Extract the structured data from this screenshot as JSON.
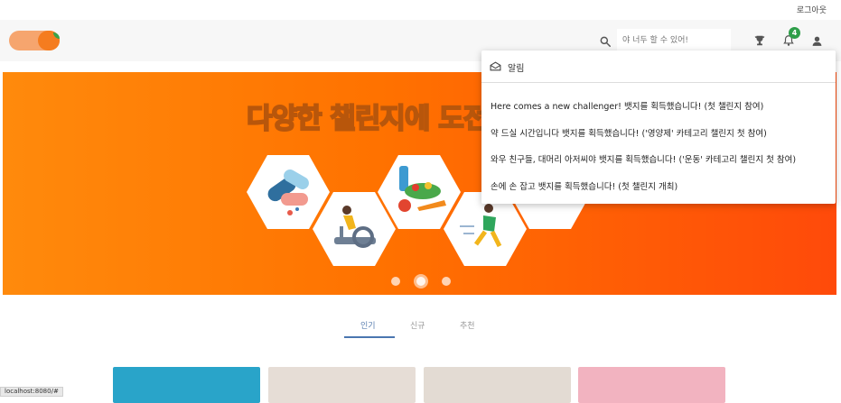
{
  "topbar": {
    "logout_label": "로그아웃"
  },
  "header": {
    "search_placeholder": "야 너두 할 수 있어!",
    "notification_count": "4",
    "icons": [
      "search-icon",
      "trophy-icon",
      "bell-icon",
      "person-icon"
    ]
  },
  "banner": {
    "title": "다양한 챌린지에 도전",
    "carousel": {
      "slide_count": 3,
      "active_slide": 2
    }
  },
  "notifications": {
    "header_label": "알림",
    "items": [
      "Here comes a new challenger! 뱃지를 획득했습니다! (첫 챌린지 참여)",
      "약 드실 시간입니다 뱃지를 획득했습니다! ('영양제' 카테고리 챌린지 첫 참여)",
      "와우 친구들, 대머리 아저씨야 뱃지를 획득했습니다! ('운동' 카테고리 챌린지 첫 참여)",
      "손에 손 잡고 뱃지를 획득했습니다! (첫 챌린지 개최)"
    ]
  },
  "tabs": [
    {
      "label": "인기",
      "active": true
    },
    {
      "label": "신규",
      "active": false
    },
    {
      "label": "추천",
      "active": false
    }
  ],
  "status_bar": {
    "url": "localhost:8080/#"
  },
  "colors": {
    "accent": "#ff7a00",
    "badge": "#2e9e49",
    "tab_active": "#4a76b0"
  }
}
